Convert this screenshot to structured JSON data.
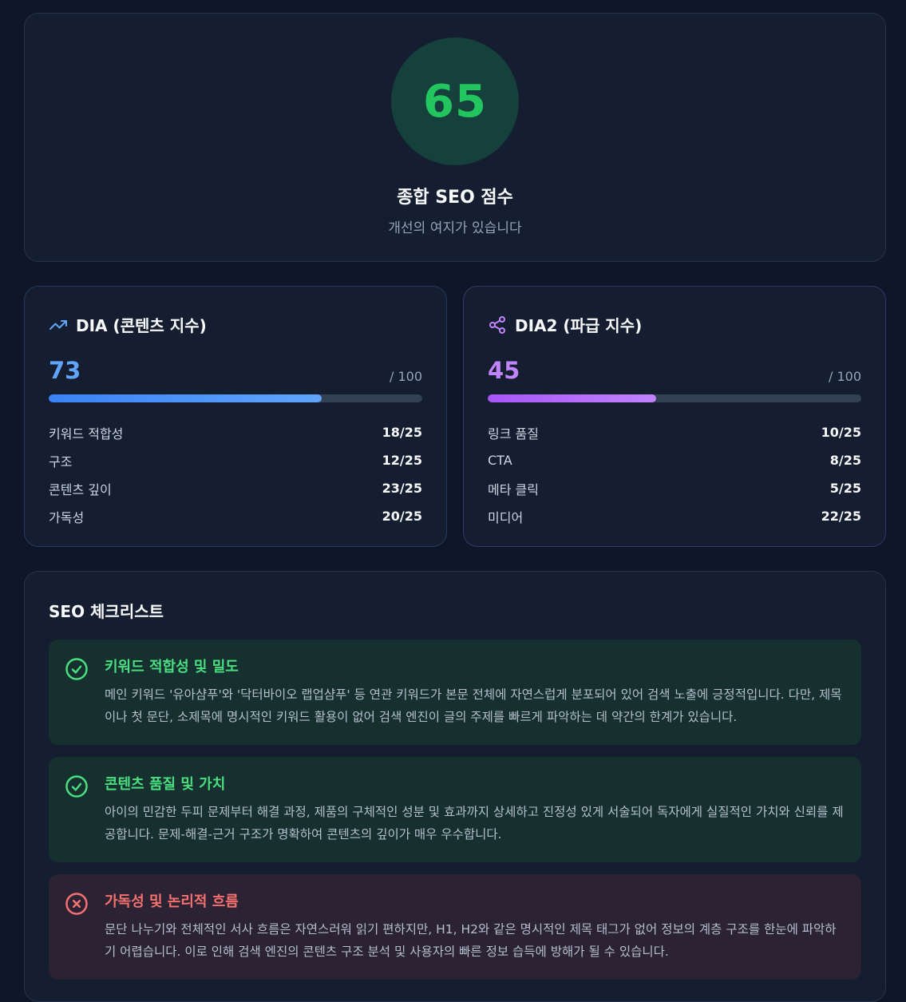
{
  "overall": {
    "score": "65",
    "title": "종합 SEO 점수",
    "subtitle": "개선의 여지가 있습니다",
    "colors": {
      "score": "#22c55e",
      "circle_bg": "#15403b"
    }
  },
  "dia": {
    "icon": "trending-up-icon",
    "title": "DIA (콘텐츠 지수)",
    "score": "73",
    "max": "/ 100",
    "progress_fraction": 0.73,
    "accent": "#60a5fa",
    "metrics": [
      {
        "label": "키워드 적합성",
        "value": "18/25"
      },
      {
        "label": "구조",
        "value": "12/25"
      },
      {
        "label": "콘텐츠 깊이",
        "value": "23/25"
      },
      {
        "label": "가독성",
        "value": "20/25"
      }
    ]
  },
  "dia2": {
    "icon": "share-icon",
    "title": "DIA2 (파급 지수)",
    "score": "45",
    "max": "/ 100",
    "progress_fraction": 0.45,
    "accent": "#c084fc",
    "metrics": [
      {
        "label": "링크 품질",
        "value": "10/25"
      },
      {
        "label": "CTA",
        "value": "8/25"
      },
      {
        "label": "메타 클릭",
        "value": "5/25"
      },
      {
        "label": "미디어",
        "value": "22/25"
      }
    ]
  },
  "checklist": {
    "title": "SEO 체크리스트",
    "items": [
      {
        "status": "pass",
        "icon": "check-circle-icon",
        "title": "키워드 적합성 및 밀도",
        "description": "메인 키워드 '유아샴푸'와 '닥터바이오 랩업샴푸' 등 연관 키워드가 본문 전체에 자연스럽게 분포되어 있어 검색 노출에 긍정적입니다. 다만, 제목이나 첫 문단, 소제목에 명시적인 키워드 활용이 없어 검색 엔진이 글의 주제를 빠르게 파악하는 데 약간의 한계가 있습니다."
      },
      {
        "status": "pass",
        "icon": "check-circle-icon",
        "title": "콘텐츠 품질 및 가치",
        "description": "아이의 민감한 두피 문제부터 해결 과정, 제품의 구체적인 성분 및 효과까지 상세하고 진정성 있게 서술되어 독자에게 실질적인 가치와 신뢰를 제공합니다. 문제-해결-근거 구조가 명확하여 콘텐츠의 깊이가 매우 우수합니다."
      },
      {
        "status": "fail",
        "icon": "x-circle-icon",
        "title": "가독성 및 논리적 흐름",
        "description": "문단 나누기와 전체적인 서사 흐름은 자연스러워 읽기 편하지만, H1, H2와 같은 명시적인 제목 태그가 없어 정보의 계층 구조를 한눈에 파악하기 어렵습니다. 이로 인해 검색 엔진의 콘텐츠 구조 분석 및 사용자의 빠른 정보 습득에 방해가 될 수 있습니다."
      }
    ]
  }
}
